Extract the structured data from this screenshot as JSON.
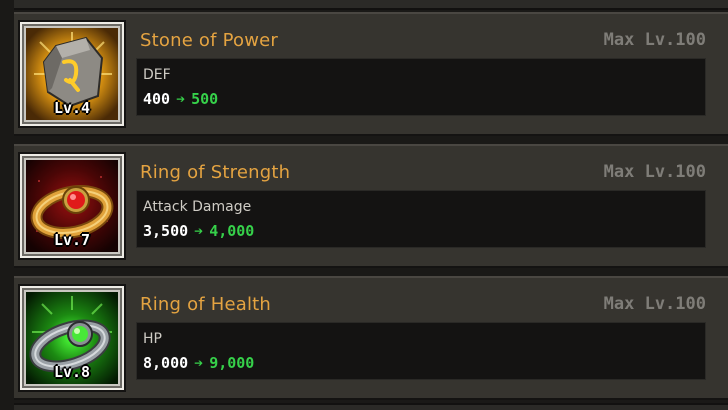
{
  "items": [
    {
      "name": "Stone of Power",
      "level_label": "Lv.4",
      "max_level_label": "Max Lv.100",
      "stat_name": "DEF",
      "current_value": "400",
      "arrow": "➔",
      "next_value": "500",
      "icon": "power-stone-icon",
      "glow_color": "#f2b01f"
    },
    {
      "name": "Ring of Strength",
      "level_label": "Lv.7",
      "max_level_label": "Max Lv.100",
      "stat_name": "Attack Damage",
      "current_value": "3,500",
      "arrow": "➔",
      "next_value": "4,000",
      "icon": "ruby-ring-icon",
      "glow_color": "#c21818"
    },
    {
      "name": "Ring of Health",
      "level_label": "Lv.8",
      "max_level_label": "Max Lv.100",
      "stat_name": "HP",
      "current_value": "8,000",
      "arrow": "➔",
      "next_value": "9,000",
      "icon": "emerald-ring-icon",
      "glow_color": "#2fd32a"
    }
  ],
  "colors": {
    "item_name": "#e4a341",
    "max_level": "#7f7d78",
    "increase": "#36d14a",
    "panel": "#36342f",
    "stat_box": "#141312"
  }
}
